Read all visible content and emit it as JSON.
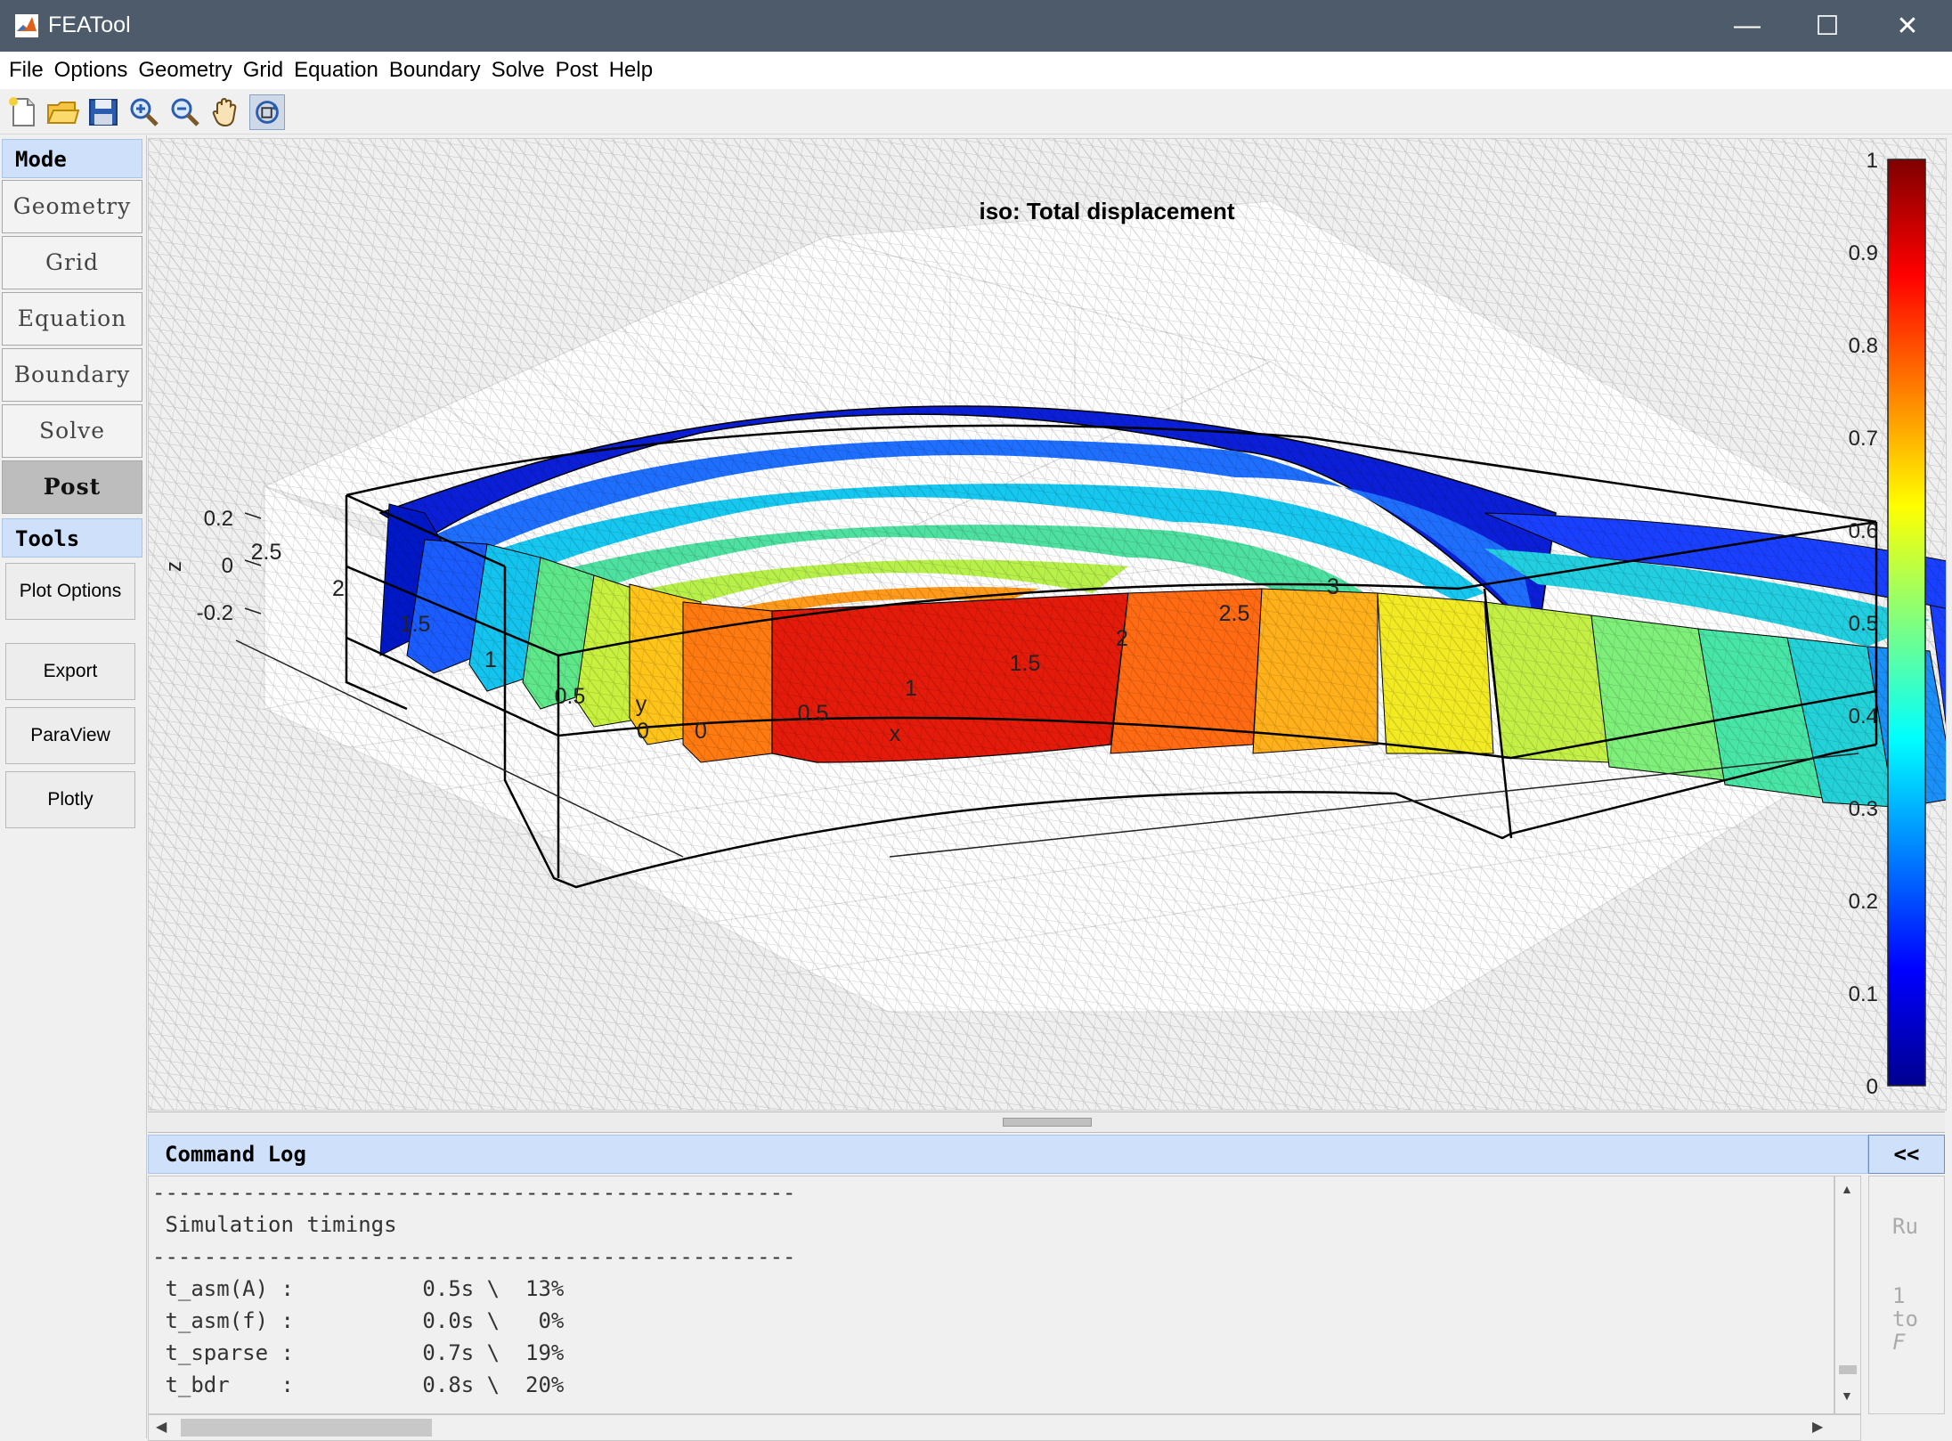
{
  "window": {
    "title": "FEATool",
    "minimize": "—",
    "maximize": "☐",
    "close": "✕"
  },
  "menu": [
    "File",
    "Options",
    "Geometry",
    "Grid",
    "Equation",
    "Boundary",
    "Solve",
    "Post",
    "Help"
  ],
  "toolbar": [
    "new-file-icon",
    "open-folder-icon",
    "save-icon",
    "zoom-in-icon",
    "zoom-out-icon",
    "pan-hand-icon",
    "rotate-3d-icon"
  ],
  "left_panel": {
    "mode_header": "Mode",
    "modes": [
      "Geometry",
      "Grid",
      "Equation",
      "Boundary",
      "Solve",
      "Post"
    ],
    "active_mode": "Post",
    "tools_header": "Tools",
    "tools": [
      "Plot Options",
      "Export",
      "ParaView",
      "Plotly"
    ]
  },
  "plot": {
    "title": "iso: Total displacement",
    "xlabel": "x",
    "ylabel": "y",
    "zlabel": "z",
    "x_ticks": [
      "0",
      "0.5",
      "1",
      "1.5",
      "2",
      "2.5",
      "3"
    ],
    "y_ticks": [
      "0",
      "0.5",
      "1",
      "1.5",
      "2",
      "2.5"
    ],
    "z_ticks": [
      "0.2",
      "0",
      "-0.2"
    ],
    "colorbar_ticks": [
      "1",
      "0.9",
      "0.8",
      "0.7",
      "0.6",
      "0.5",
      "0.4",
      "0.3",
      "0.2",
      "0.1",
      "0"
    ],
    "colormap": "jet"
  },
  "log": {
    "title": "Command Log",
    "toggle": "<<",
    "lines": [
      "--------------------------------------------------",
      " Simulation timings",
      "--------------------------------------------------",
      " t_asm(A) :          0.5s \\  13%",
      " t_asm(f) :          0.0s \\   0%",
      " t_sparse :          0.7s \\  19%",
      " t_bdr    :          0.8s \\  20%"
    ],
    "side": [
      "Ru",
      "1",
      "to",
      "F"
    ]
  }
}
